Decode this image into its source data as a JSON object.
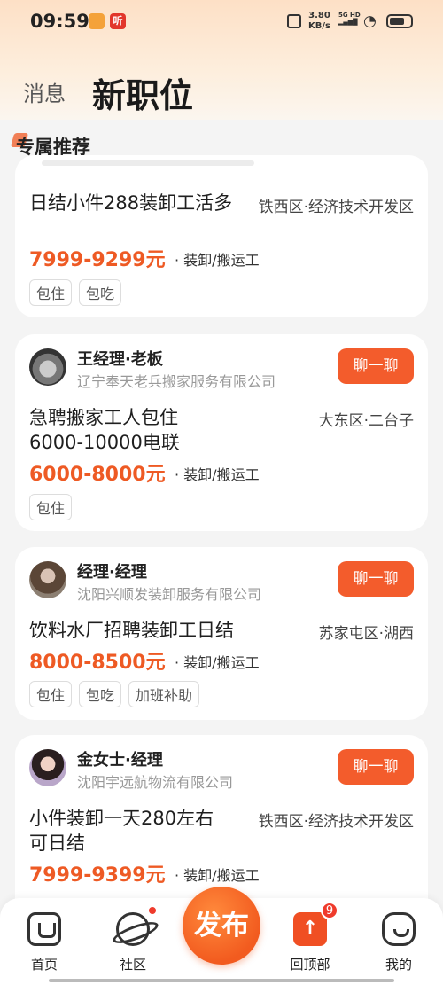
{
  "status": {
    "time": "09:59",
    "speed_value": "3.80",
    "speed_unit": "KB/s",
    "network": "5G HD"
  },
  "tabs": {
    "messages": "消息",
    "new_jobs": "新职位"
  },
  "section_title": "专属推荐",
  "jobs": [
    {
      "title": "日结小件288装卸工活多",
      "location": "铁西区·经济技术开发区",
      "salary": "7999-9299元",
      "category": "· 装卸/搬运工",
      "tags": [
        "包住",
        "包吃"
      ]
    },
    {
      "recruiter": "王经理·老板",
      "company": "辽宁奉天老兵搬家服务有限公司",
      "chat_label": "聊一聊",
      "title_lines": [
        "急聘搬家工人包住",
        "6000-10000电联"
      ],
      "location": "大东区·二台子",
      "salary": "6000-8000元",
      "category": "· 装卸/搬运工",
      "tags": [
        "包住"
      ]
    },
    {
      "recruiter": "经理·经理",
      "company": "沈阳兴顺发装卸服务有限公司",
      "chat_label": "聊一聊",
      "title": "饮料水厂招聘装卸工日结",
      "location": "苏家屯区·湖西",
      "salary": "8000-8500元",
      "category": "· 装卸/搬运工",
      "tags": [
        "包住",
        "包吃",
        "加班补助"
      ]
    },
    {
      "recruiter": "金女士·经理",
      "company": "沈阳宇远航物流有限公司",
      "chat_label": "聊一聊",
      "title_lines": [
        "小件装卸一天280左右",
        "可日结"
      ],
      "location": "铁西区·经济技术开发区",
      "salary": "7999-9399元",
      "category": "· 装卸/搬运工"
    }
  ],
  "nav": {
    "home": "首页",
    "community": "社区",
    "publish": "发布",
    "back_top": "回顶部",
    "back_top_badge": "9",
    "me": "我的"
  },
  "colors": {
    "accent": "#f35c2c",
    "salary": "#ee5a24"
  }
}
